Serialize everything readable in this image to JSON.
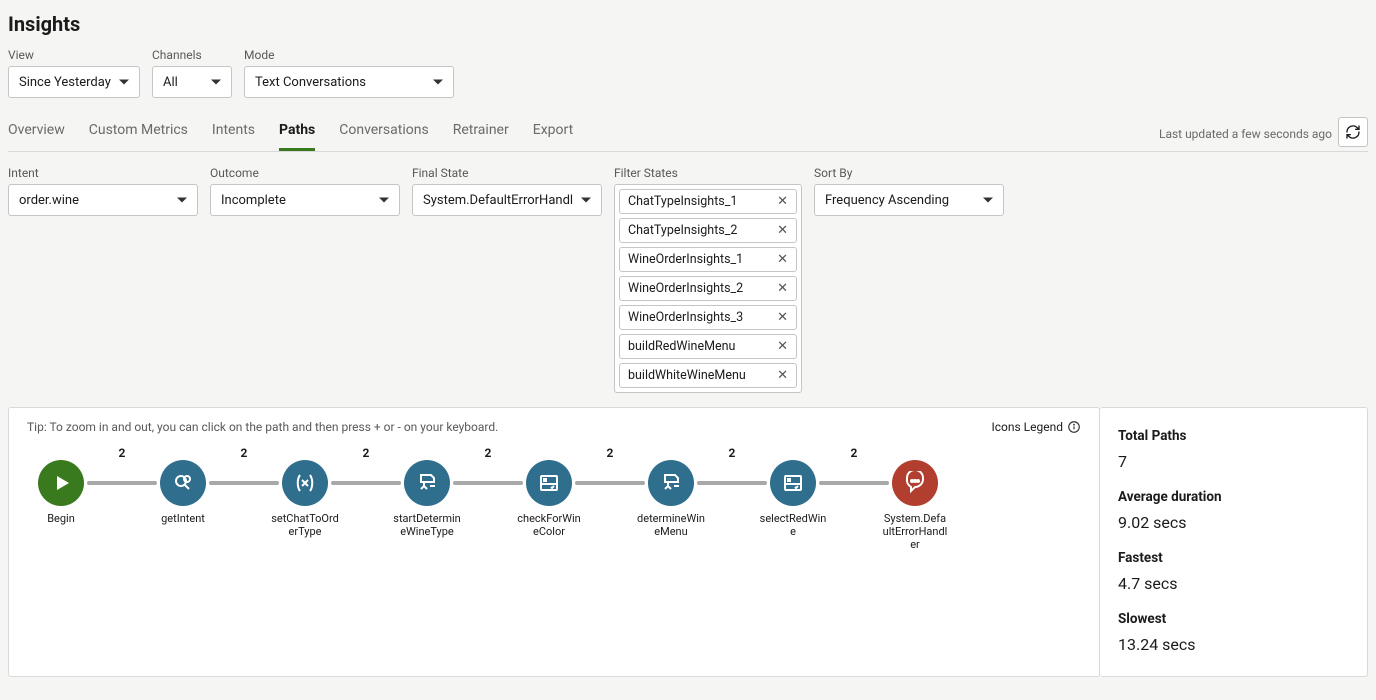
{
  "header": {
    "title": "Insights"
  },
  "top_filters": {
    "view": {
      "label": "View",
      "value": "Since Yesterday"
    },
    "channels": {
      "label": "Channels",
      "value": "All"
    },
    "mode": {
      "label": "Mode",
      "value": "Text Conversations"
    }
  },
  "tabs": {
    "items": [
      "Overview",
      "Custom Metrics",
      "Intents",
      "Paths",
      "Conversations",
      "Retrainer",
      "Export"
    ],
    "active_index": 3
  },
  "last_updated": "Last updated a few seconds ago",
  "path_filters": {
    "intent": {
      "label": "Intent",
      "value": "order.wine"
    },
    "outcome": {
      "label": "Outcome",
      "value": "Incomplete"
    },
    "final_state": {
      "label": "Final State",
      "value": "System.DefaultErrorHandle"
    },
    "filter_states": {
      "label": "Filter States",
      "chips": [
        "ChatTypeInsights_1",
        "ChatTypeInsights_2",
        "WineOrderInsights_1",
        "WineOrderInsights_2",
        "WineOrderInsights_3",
        "buildRedWineMenu",
        "buildWhiteWineMenu"
      ]
    },
    "sort_by": {
      "label": "Sort By",
      "value": "Frequency Ascending"
    }
  },
  "viz": {
    "tip": "Tip: To zoom in and out, you can click on the path and then press + or - on your keyboard.",
    "legend": "Icons Legend",
    "nodes": [
      {
        "label": "Begin",
        "type": "start",
        "color": "green"
      },
      {
        "label": "getIntent",
        "type": "intent",
        "color": "blue"
      },
      {
        "label": "setChatToOrderType",
        "type": "var",
        "color": "blue"
      },
      {
        "label": "startDetermineWineType",
        "type": "flow",
        "color": "blue"
      },
      {
        "label": "checkForWineColor",
        "type": "card",
        "color": "blue"
      },
      {
        "label": "determineWineMenu",
        "type": "flow",
        "color": "blue"
      },
      {
        "label": "selectRedWine",
        "type": "card",
        "color": "blue"
      },
      {
        "label": "System.DefaultErrorHandler",
        "type": "error",
        "color": "red"
      }
    ],
    "edge_counts": [
      "2",
      "2",
      "2",
      "2",
      "2",
      "2",
      "2"
    ]
  },
  "stats": {
    "total_paths": {
      "label": "Total Paths",
      "value": "7"
    },
    "avg_duration": {
      "label": "Average duration",
      "value": "9.02 secs"
    },
    "fastest": {
      "label": "Fastest",
      "value": "4.7 secs"
    },
    "slowest": {
      "label": "Slowest",
      "value": "13.24 secs"
    }
  }
}
